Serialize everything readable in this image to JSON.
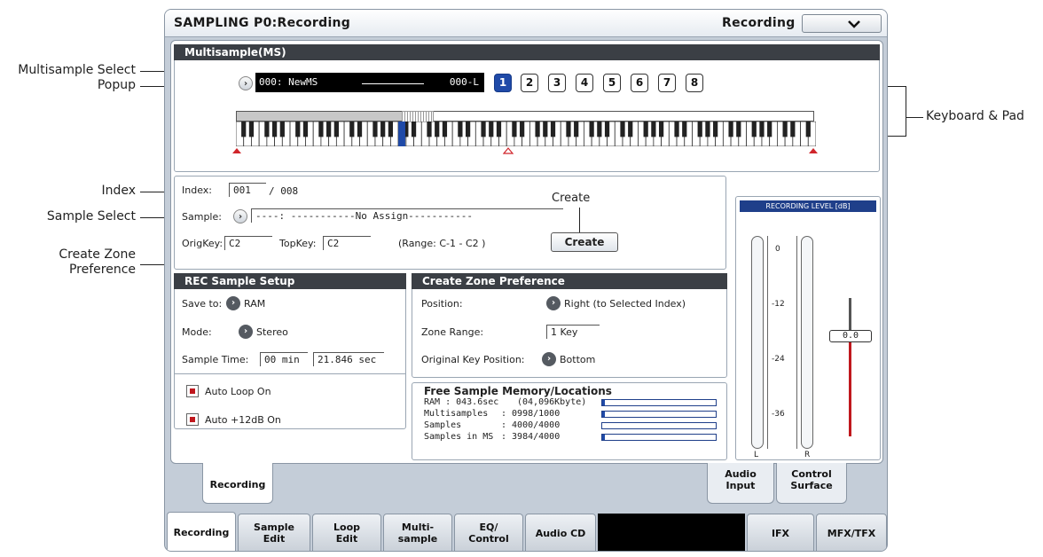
{
  "window": {
    "title": "SAMPLING P0:Recording",
    "page_label": "Recording"
  },
  "multisample": {
    "header": "Multisample(MS)",
    "select_value": "000: NewMS",
    "select_suffix": "000-L",
    "pads": [
      "1",
      "2",
      "3",
      "4",
      "5",
      "6",
      "7",
      "8"
    ],
    "selected_pad": "1"
  },
  "index": {
    "label": "Index:",
    "value": "001",
    "total": "/ 008"
  },
  "sample": {
    "label": "Sample:",
    "value": "----: -----------No Assign-----------",
    "origkey_label": "OrigKey:",
    "origkey_value": "C2",
    "topkey_label": "TopKey:",
    "topkey_value": "C2",
    "range_text": "(Range: C-1   - C2   )",
    "create_caption": "Create",
    "create_button": "Create"
  },
  "rec_setup": {
    "header": "REC Sample Setup",
    "save_to_label": "Save to:",
    "save_to_value": "RAM",
    "mode_label": "Mode:",
    "mode_value": "Stereo",
    "sample_time_label": "Sample Time:",
    "sample_time_min": "00 min",
    "sample_time_sec": "21.846 sec",
    "auto_loop": "Auto Loop On",
    "auto_12db": "Auto +12dB On"
  },
  "zone_pref": {
    "header": "Create Zone Preference",
    "position_label": "Position:",
    "position_value": "Right (to Selected Index)",
    "zone_range_label": "Zone Range:",
    "zone_range_value": "1 Key",
    "orig_key_pos_label": "Original Key Position:",
    "orig_key_pos_value": "Bottom"
  },
  "memory": {
    "header": "Free Sample Memory/Locations",
    "rows": [
      {
        "label": "RAM : 043.6sec",
        "value": "(04,096Kbyte)",
        "fill": 0.02
      },
      {
        "label": "Multisamples",
        "value": ": 0998/1000",
        "fill": 0.02
      },
      {
        "label": "Samples",
        "value": ": 4000/4000",
        "fill": 0.0
      },
      {
        "label": "Samples in MS",
        "value": ": 3984/4000",
        "fill": 0.02
      }
    ]
  },
  "level": {
    "header": "RECORDING LEVEL [dB]",
    "scale": [
      "0",
      "-12",
      "-24",
      "-36"
    ],
    "left": "L",
    "right": "R",
    "value": "0.0"
  },
  "sub_tabs": {
    "recording": "Recording",
    "audio_input": "Audio Input",
    "control_surface": "Control Surface"
  },
  "main_tabs": [
    "Recording",
    "Sample Edit",
    "Loop Edit",
    "Multi- sample",
    "EQ/ Control",
    "Audio CD",
    "IFX",
    "MFX/TFX"
  ],
  "annotations": {
    "multisample_select": "Multisample Select",
    "popup": "Popup",
    "keyboard_pad": "Keyboard & Pad",
    "index": "Index",
    "sample_select": "Sample Select",
    "create_zone": "Create Zone",
    "preference": "Preference"
  }
}
